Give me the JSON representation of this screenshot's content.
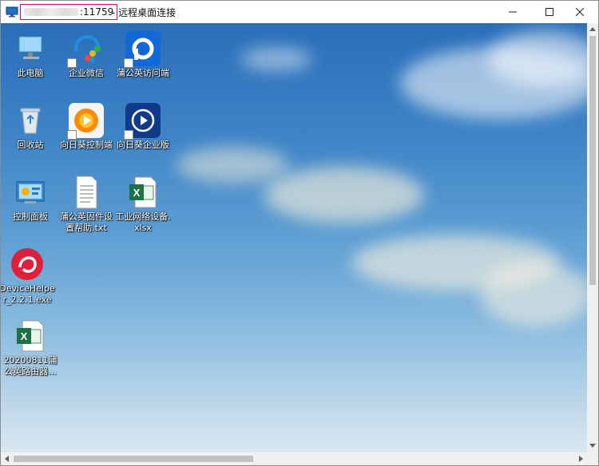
{
  "titlebar": {
    "port": ":11759",
    "title": "- 远程桌面连接"
  },
  "icons": {
    "this_pc": "此电脑",
    "wecom": "企业微信",
    "pgy_client": "蒲公英访问端",
    "recycle_bin": "回收站",
    "sunlogin_control": "向日葵控制端",
    "sunlogin_enterprise": "向日葵企业版",
    "control_panel": "控制面板",
    "firmware_help": "蒲公英固件设置帮助.txt",
    "industrial_xlsx": "工业网络设备.xlsx",
    "devicehelper": "DeviceHelper_2.2.1.exe",
    "router_xlsx": "20200811蒲公英路由器..."
  },
  "colors": {
    "title_highlight": "#d2007a",
    "desktop_sky": "#3c83c6",
    "excel_green": "#1e7145"
  }
}
